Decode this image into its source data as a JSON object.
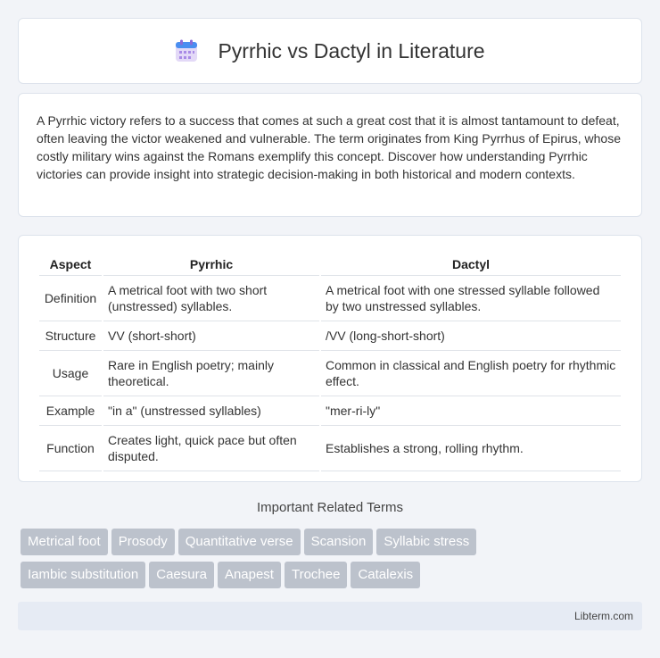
{
  "header": {
    "title": "Pyrrhic vs Dactyl in Literature",
    "icon": "calendar-icon"
  },
  "intro": {
    "text": "A Pyrrhic victory refers to a success that comes at such a great cost that it is almost tantamount to defeat, often leaving the victor weakened and vulnerable. The term originates from King Pyrrhus of Epirus, whose costly military wins against the Romans exemplify this concept. Discover how understanding Pyrrhic victories can provide insight into strategic decision-making in both historical and modern contexts."
  },
  "table": {
    "headers": [
      "Aspect",
      "Pyrrhic",
      "Dactyl"
    ],
    "rows": [
      [
        "Definition",
        "A metrical foot with two short (unstressed) syllables.",
        "A metrical foot with one stressed syllable followed by two unstressed syllables."
      ],
      [
        "Structure",
        "VV (short-short)",
        "/VV (long-short-short)"
      ],
      [
        "Usage",
        "Rare in English poetry; mainly theoretical.",
        "Common in classical and English poetry for rhythmic effect."
      ],
      [
        "Example",
        "\"in a\" (unstressed syllables)",
        "\"mer-ri-ly\""
      ],
      [
        "Function",
        "Creates light, quick pace but often disputed.",
        "Establishes a strong, rolling rhythm."
      ]
    ]
  },
  "related": {
    "title": "Important Related Terms",
    "tags": [
      "Metrical foot",
      "Prosody",
      "Quantitative verse",
      "Scansion",
      "Syllabic stress",
      "Iambic substitution",
      "Caesura",
      "Anapest",
      "Trochee",
      "Catalexis"
    ]
  },
  "footer": {
    "text": "Libterm.com"
  }
}
